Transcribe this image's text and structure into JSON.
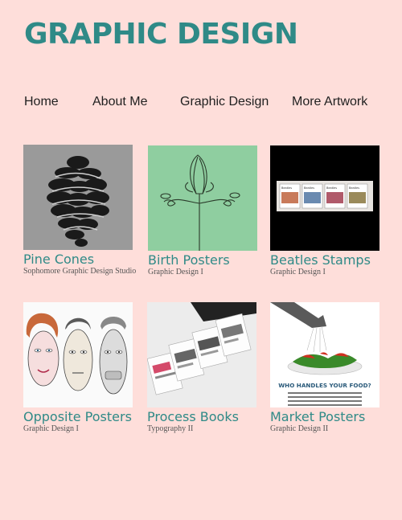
{
  "header": {
    "title": "GRAPHIC DESIGN"
  },
  "nav": {
    "items": [
      {
        "label": "Home"
      },
      {
        "label": "About Me"
      },
      {
        "label": "Graphic Design"
      },
      {
        "label": "More Artwork"
      }
    ]
  },
  "colors": {
    "background": "#FEDEDA",
    "accent": "#2F8A87",
    "text": "#1f1f1f"
  },
  "gallery": {
    "items": [
      {
        "title": "Pine Cones",
        "subtitle": "Sophomore Graphic Design Studio"
      },
      {
        "title": "Birth Posters",
        "subtitle": "Graphic Design I"
      },
      {
        "title": "Beatles Stamps",
        "subtitle": "Graphic Design I",
        "thumb_text": [
          "Beatles",
          "Beatles",
          "Beatles",
          "Beatles"
        ]
      },
      {
        "title": "Opposite Posters",
        "subtitle": "Graphic Design I"
      },
      {
        "title": "Process Books",
        "subtitle": "Typography II"
      },
      {
        "title": "Market Posters",
        "subtitle": "Graphic Design II",
        "thumb_text": "WHO HANDLES YOUR FOOD?"
      }
    ]
  }
}
